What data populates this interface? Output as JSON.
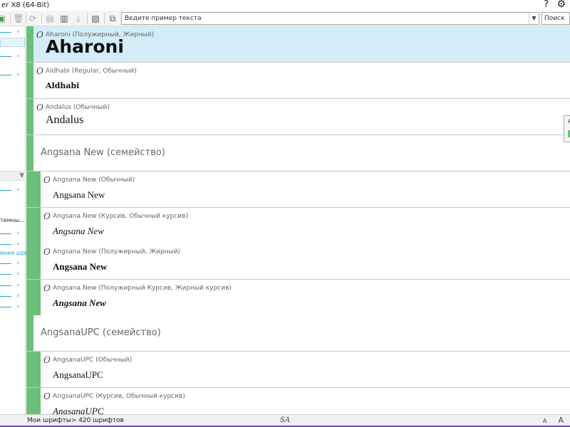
{
  "window": {
    "title": "er X8 (64-Bit)",
    "help_glyph": "?",
    "settings_glyph": "⚙"
  },
  "toolbar": {
    "sample_text": "Ведите пример текста",
    "search_placeholder": "Поиск",
    "icons": [
      "add-collection-icon",
      "delete-icon",
      "refresh-icon",
      "font-info-icon",
      "add-font-icon",
      "install-icon",
      "remove-font-icon",
      "view-mode-icon"
    ]
  },
  "left_panel": {
    "text_system": "темны...",
    "text_link": "ения шри"
  },
  "fonts": [
    {
      "kind": "font",
      "meta": "Aharoni (Полужирный, Жирный)",
      "sample": "Aharoni",
      "selected": true
    },
    {
      "kind": "font",
      "meta": "Aldhabi (Regular, Обычный)",
      "sample": "Aldhabi"
    },
    {
      "kind": "font",
      "meta": "Andalus (Обычный)",
      "sample": "Andalus"
    },
    {
      "kind": "family",
      "label": "Angsana New (семейство)"
    },
    {
      "kind": "child",
      "meta": "Angsana New (Обычный)",
      "sample": "Angsana New",
      "style": "regular"
    },
    {
      "kind": "child",
      "meta": "Angsana New (Курсив, Обычный курсив)",
      "sample": "Angsana New",
      "style": "italic"
    },
    {
      "kind": "child",
      "meta": "Angsana New (Полужирный, Жирный)",
      "sample": "Angsana New",
      "style": "bold"
    },
    {
      "kind": "child",
      "meta": "Angsana New (Полужирный Курсив, Жирный курсив)",
      "sample": "Angsana New",
      "style": "bold-italic"
    },
    {
      "kind": "family",
      "label": "AngsanaUPC (семейство)"
    },
    {
      "kind": "child",
      "meta": "AngsanaUPC (Обычный)",
      "sample": "AngsanaUPC",
      "style": "regular"
    },
    {
      "kind": "child",
      "meta": "AngsanaUPC (Курсив, Обычный курсив)",
      "sample": "AngsanaUPC",
      "style": "italic"
    }
  ],
  "popup": {
    "letter": "A"
  },
  "status": {
    "text": "Мои шрифты> 420 шрифтов",
    "mid_glyph": "SA",
    "size_glyph": "A",
    "size_glyph_small": "A"
  },
  "colors": {
    "accent_green": "#6bbf7a",
    "selection": "#d4ecf7",
    "link_blue": "#2aa0c8",
    "status_purple": "#6b4fb5"
  }
}
